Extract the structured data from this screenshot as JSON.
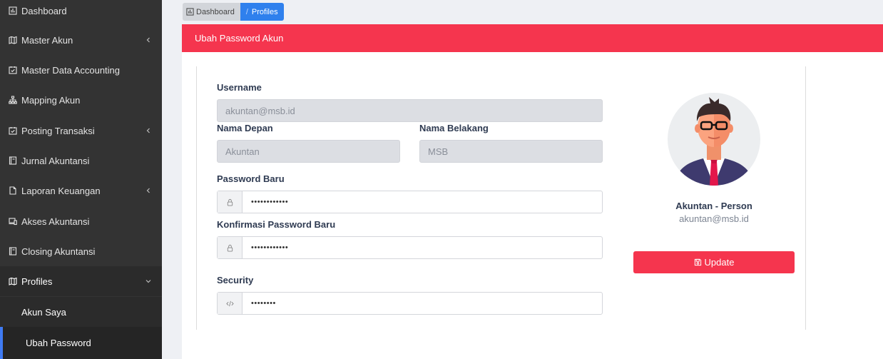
{
  "sidebar": {
    "items": [
      {
        "label": "Dashboard",
        "icon": "bar-chart-icon"
      },
      {
        "label": "Master Akun",
        "icon": "map-icon"
      },
      {
        "label": "Master Data Accounting",
        "icon": "calendar-check-icon"
      },
      {
        "label": "Mapping Akun",
        "icon": "sitemap-icon"
      },
      {
        "label": "Posting Transaksi",
        "icon": "calendar-check-icon"
      },
      {
        "label": "Jurnal Akuntansi",
        "icon": "book-icon"
      },
      {
        "label": "Laporan Keuangan",
        "icon": "file-icon"
      },
      {
        "label": "Akses Akuntansi",
        "icon": "devices-icon"
      },
      {
        "label": "Closing Akuntansi",
        "icon": "book-icon"
      },
      {
        "label": "Profiles",
        "icon": "map-icon"
      }
    ],
    "sub_items": [
      {
        "label": "Akun Saya"
      },
      {
        "label": "Ubah Password"
      }
    ]
  },
  "breadcrumb": {
    "home": "Dashboard",
    "separator": "/",
    "current": "Profiles"
  },
  "card": {
    "title": "Ubah Password Akun"
  },
  "form": {
    "username_label": "Username",
    "username_value": "akuntan@msb.id",
    "first_name_label": "Nama Depan",
    "first_name_value": "Akuntan",
    "last_name_label": "Nama Belakang",
    "last_name_value": "MSB",
    "new_password_label": "Password Baru",
    "new_password_value": "••••••••••••",
    "confirm_password_label": "Konfirmasi Password Baru",
    "confirm_password_value": "••••••••••••",
    "security_label": "Security",
    "security_value": "••••••••"
  },
  "profile": {
    "name": "Akuntan - Person",
    "email": "akuntan@msb.id",
    "update_label": "Update"
  },
  "colors": {
    "accent": "#f5354e",
    "sidebar_bg": "#333333",
    "breadcrumb_active": "#2f80ed"
  }
}
